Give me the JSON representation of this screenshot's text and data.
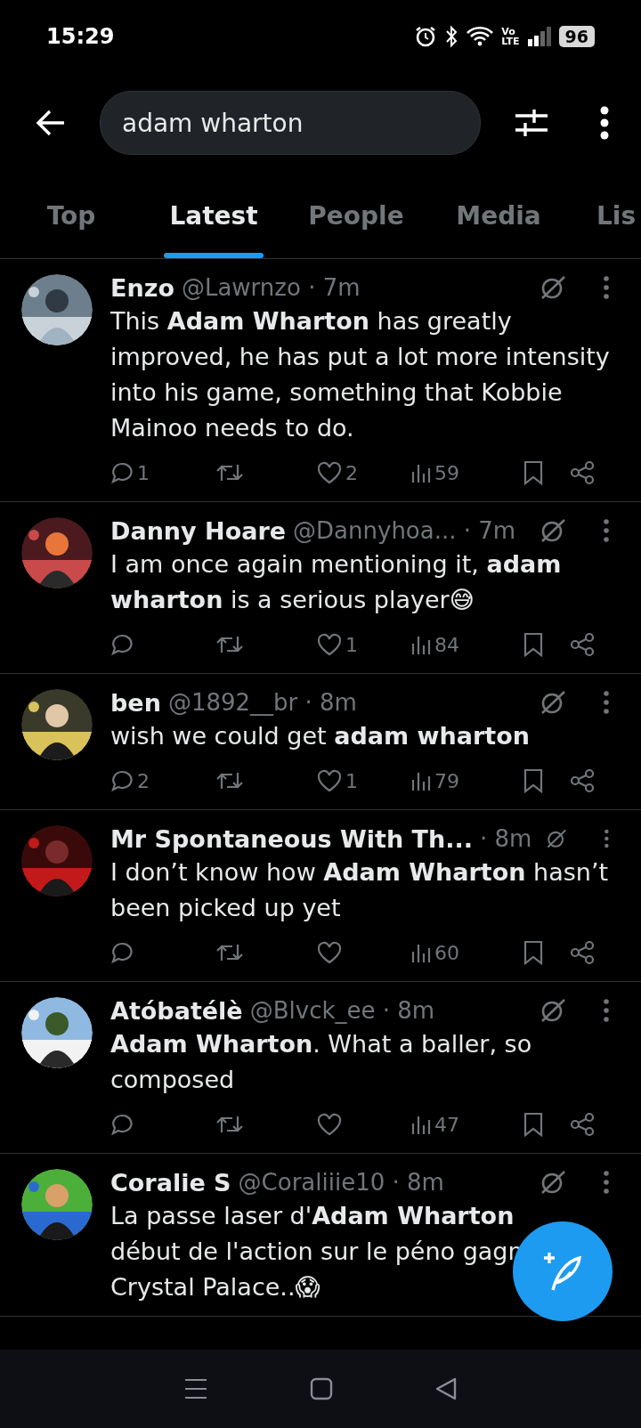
{
  "status_bar": {
    "time": "15:29",
    "network_label": [
      "Vo",
      "LTE"
    ],
    "battery": "96"
  },
  "search": {
    "value": "adam wharton"
  },
  "tabs": [
    {
      "label": "Top",
      "selected": false
    },
    {
      "label": "Latest",
      "selected": true
    },
    {
      "label": "People",
      "selected": false
    },
    {
      "label": "Media",
      "selected": false
    },
    {
      "label": "Lis",
      "selected": false
    }
  ],
  "tweets": [
    {
      "name": "Enzo",
      "meta": "@Lawrnzo · 7m",
      "text": "This **Adam Wharton** has greatly improved, he has put a lot more intensity into his game, something that Kobbie Mainoo needs to do.",
      "replies": "1",
      "likes": "2",
      "views": "59"
    },
    {
      "name": "Danny Hoare",
      "meta": "@Dannyhoa...  · 7m",
      "text": "I am once again mentioning it, **adam wharton** is a serious player😅",
      "likes": "1",
      "views": "84"
    },
    {
      "name": "ben",
      "meta": "@1892__br · 8m",
      "text": "wish we could get **adam wharton**",
      "replies": "2",
      "likes": "1",
      "views": "79"
    },
    {
      "name": "Mr Spontaneous With Th...",
      "meta": "· 8m",
      "text": "I don’t know how **Adam Wharton** hasn’t been picked up yet",
      "views": "60"
    },
    {
      "name": "Atóbatélè",
      "meta": "@Blvck_ee · 8m",
      "text": "**Adam Wharton**. What a baller, so composed",
      "views": "47"
    },
    {
      "name": "Coralie S",
      "meta": "@Coraliiie10 · 8m",
      "text_lines": [
        "La passe laser d'**Adam Wharton**",
        "début de l'action sur le péno gagn",
        "Crystal Palace..😱"
      ]
    }
  ]
}
